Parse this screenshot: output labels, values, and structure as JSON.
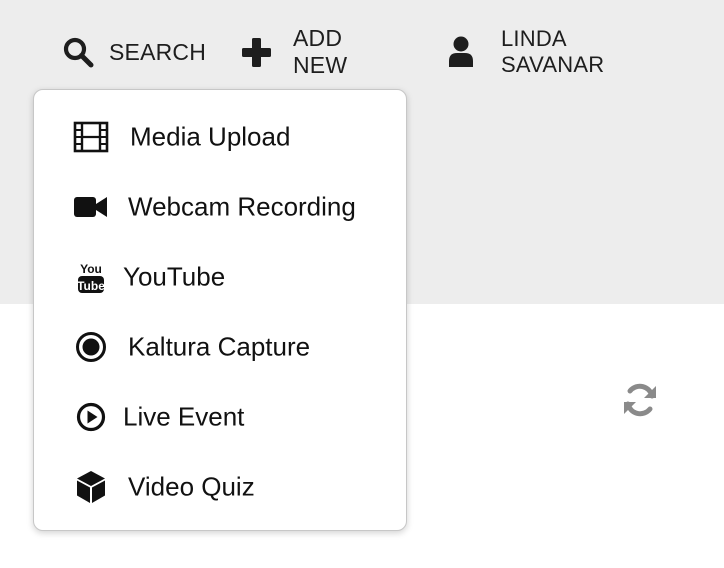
{
  "topnav": {
    "search_label": "SEARCH",
    "add_new_label": "ADD NEW",
    "user_name": "LINDA SAVANAR"
  },
  "add_new_menu": {
    "items": [
      {
        "label": "Media Upload",
        "icon": "film-icon"
      },
      {
        "label": "Webcam Recording",
        "icon": "video-camera-icon"
      },
      {
        "label": "YouTube",
        "icon": "youtube-icon"
      },
      {
        "label": "Kaltura Capture",
        "icon": "record-icon"
      },
      {
        "label": "Live Event",
        "icon": "play-circle-icon"
      },
      {
        "label": "Video Quiz",
        "icon": "cube-icon"
      }
    ]
  },
  "content": {
    "refresh_icon": "refresh-icon"
  },
  "colors": {
    "header_background": "#ededed",
    "text": "#1e1e1e",
    "refresh_icon": "#8a8a8a"
  }
}
